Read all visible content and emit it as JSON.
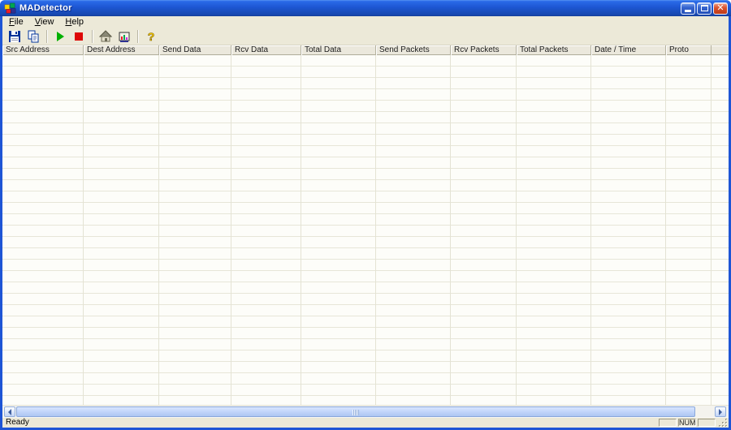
{
  "window": {
    "title": "MADetector",
    "controls": {
      "minimize": "minimize-button",
      "maximize": "maximize-button",
      "close": "close-button"
    }
  },
  "menu_bar": {
    "items": [
      {
        "label": "File"
      },
      {
        "label": "View"
      },
      {
        "label": "Help"
      }
    ]
  },
  "toolbar": {
    "buttons": [
      {
        "name": "save",
        "icon": "floppy-disk-icon"
      },
      {
        "name": "copy",
        "icon": "copy-pages-icon"
      },
      {
        "name": "start-capture",
        "icon": "play-icon"
      },
      {
        "name": "stop-capture",
        "icon": "stop-icon"
      },
      {
        "name": "home",
        "icon": "home-icon"
      },
      {
        "name": "adapter-stats",
        "icon": "adapter-chart-icon"
      },
      {
        "name": "about",
        "icon": "help-question-icon"
      }
    ]
  },
  "table": {
    "columns": [
      "Src Address",
      "Dest Address",
      "Send Data",
      "Rcv Data",
      "Total Data",
      "Send Packets",
      "Rcv Packets",
      "Total Packets",
      "Date / Time",
      "Proto"
    ],
    "rows": []
  },
  "status_bar": {
    "message": "Ready",
    "indicators": [
      "",
      "NUM",
      ""
    ]
  },
  "colors": {
    "titlebar_blue": "#1D56D2",
    "chrome_beige": "#ECE9D8",
    "close_red": "#BE3A17",
    "grid_line": "#E7E6D8",
    "scroll_thumb": "#C2D5FA"
  }
}
